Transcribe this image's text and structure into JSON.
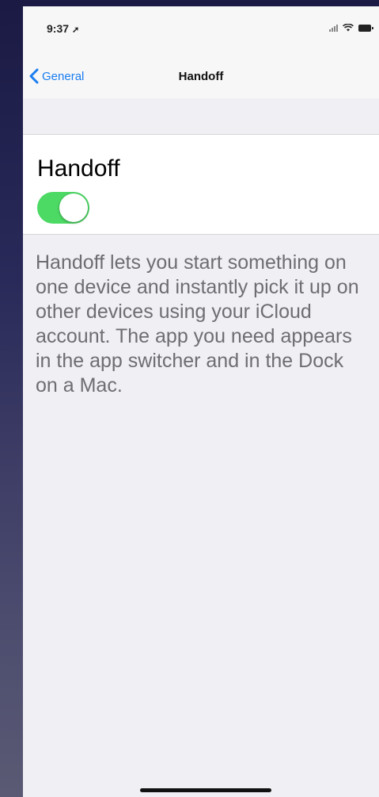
{
  "status_bar": {
    "time": "9:37",
    "icons": [
      "location-icon",
      "signal-icon",
      "wifi-icon",
      "battery-icon"
    ]
  },
  "nav": {
    "back_label": "General",
    "title": "Handoff"
  },
  "setting": {
    "title": "Handoff",
    "toggle_on": true,
    "toggle_color": "#4cd964"
  },
  "footer": {
    "text": "Handoff lets you start something on one device and instantly pick it up on other devices using your iCloud account. The app you need appears in the app switcher and in the Dock on a Mac."
  },
  "colors": {
    "accent": "#1a7df0",
    "background": "#efeff4"
  }
}
